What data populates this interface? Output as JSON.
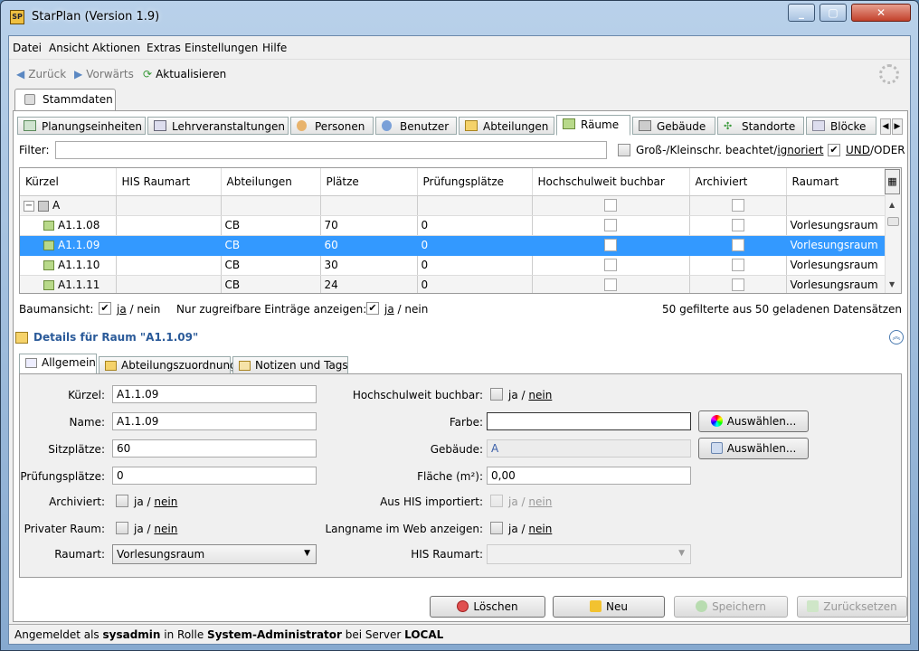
{
  "window": {
    "title": "StarPlan (Version 1.9)",
    "app_icon": "SP"
  },
  "menu": [
    "Datei",
    "Ansicht",
    "Aktionen",
    "Extras",
    "Einstellungen",
    "Hilfe"
  ],
  "nav": {
    "back": "Zurück",
    "forward": "Vorwärts",
    "refresh": "Aktualisieren"
  },
  "stammdaten_tab": "Stammdaten",
  "tabs": [
    "Planungseinheiten",
    "Lehrveranstaltungen",
    "Personen",
    "Benutzer",
    "Abteilungen",
    "Räume",
    "Gebäude",
    "Standorte",
    "Blöcke"
  ],
  "filter": {
    "label": "Filter:",
    "value": "",
    "case_text_a": "Groß-/Kleinschr. beachtet/",
    "case_text_b": "ignoriert",
    "case_checked": false,
    "und": "UND",
    "oder": "/ODER",
    "und_checked": true
  },
  "table": {
    "columns": [
      "Kürzel",
      "HIS Raumart",
      "Abteilungen",
      "Plätze",
      "Prüfungsplätze",
      "Hochschulweit buchbar",
      "Archiviert",
      "Raumart"
    ],
    "group": "A",
    "rows": [
      {
        "kuerzel": "A1.1.08",
        "his": "",
        "abt": "CB",
        "plaetze": "70",
        "pruef": "0",
        "raumart": "Vorlesungsraum"
      },
      {
        "kuerzel": "A1.1.09",
        "his": "",
        "abt": "CB",
        "plaetze": "60",
        "pruef": "0",
        "raumart": "Vorlesungsraum"
      },
      {
        "kuerzel": "A1.1.10",
        "his": "",
        "abt": "CB",
        "plaetze": "30",
        "pruef": "0",
        "raumart": "Vorlesungsraum"
      },
      {
        "kuerzel": "A1.1.11",
        "his": "",
        "abt": "CB",
        "plaetze": "24",
        "pruef": "0",
        "raumart": "Vorlesungsraum"
      }
    ]
  },
  "baum": {
    "label": "Baumansicht:",
    "ja": "ja",
    "nein": "/ nein",
    "zugreif_label": "Nur zugreifbare Einträge anzeigen:",
    "count_text": "50 gefilterte aus 50 geladenen Datensätzen"
  },
  "details": {
    "title": "Details für Raum \"A1.1.09\"",
    "tabs": [
      "Allgemein",
      "Abteilungszuordnung",
      "Notizen und Tags"
    ]
  },
  "form": {
    "kuerzel_label": "Kürzel:",
    "kuerzel": "A1.1.09",
    "name_label": "Name:",
    "name": "A1.1.09",
    "sitz_label": "Sitzplätze:",
    "sitz": "60",
    "pruef_label": "Prüfungsplätze:",
    "pruef": "0",
    "archiv_label": "Archiviert:",
    "privat_label": "Privater Raum:",
    "raumart_label": "Raumart:",
    "raumart": "Vorlesungsraum",
    "hochschul_label": "Hochschulweit buchbar:",
    "farbe_label": "Farbe:",
    "farbe": "",
    "gebaeude_label": "Gebäude:",
    "gebaeude": "A",
    "flaeche_label": "Fläche (m²):",
    "flaeche": "0,00",
    "his_import_label": "Aus HIS importiert:",
    "langname_label": "Langname im Web anzeigen:",
    "his_raumart_label": "HIS Raumart:",
    "his_raumart": "",
    "ja": "ja",
    "slash": "/",
    "nein": "nein",
    "auswaehlen": "Auswählen..."
  },
  "actions": {
    "loeschen": "Löschen",
    "neu": "Neu",
    "speichern": "Speichern",
    "zuruecksetzen": "Zurücksetzen"
  },
  "status": {
    "p1": "Angemeldet als ",
    "user": "sysadmin",
    "p2": " in Rolle ",
    "role": "System-Administrator",
    "p3": " bei Server ",
    "server": "LOCAL"
  }
}
